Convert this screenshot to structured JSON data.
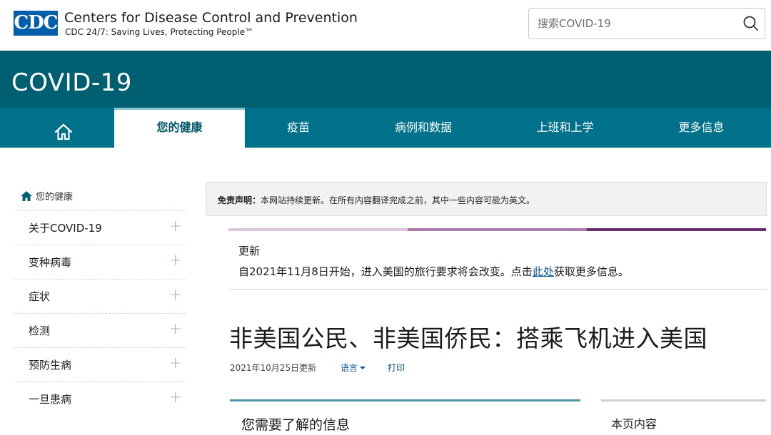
{
  "header": {
    "logo_text": "CDC",
    "agency_name": "Centers for Disease Control and Prevention",
    "tagline": "CDC 24/7: Saving Lives, Protecting People™",
    "search": {
      "placeholder": "搜索COVID-19",
      "value": ""
    }
  },
  "banner": {
    "title": "COVID-19"
  },
  "nav": {
    "items": [
      {
        "label": "",
        "icon": "home-icon"
      },
      {
        "label": "您的健康",
        "active": true
      },
      {
        "label": "疫苗"
      },
      {
        "label": "病例和数据"
      },
      {
        "label": "上班和上学"
      },
      {
        "label": "更多信息"
      }
    ]
  },
  "sidebar": {
    "home_label": "您的健康",
    "items": [
      {
        "label": "关于COVID-19"
      },
      {
        "label": "变种病毒"
      },
      {
        "label": "症状"
      },
      {
        "label": "检测"
      },
      {
        "label": "预防生病"
      },
      {
        "label": "一旦患病"
      }
    ],
    "expand_symbol": "+"
  },
  "disclaimer": {
    "label": "免责声明：",
    "text": "本网站持续更新。在所有内容翻译完成之前，其中一些内容可能为英文。"
  },
  "update": {
    "heading": "更新",
    "text_before": "自2021年11月8日开始，进入美国的旅行要求将会改变。点击",
    "link_text": "此处",
    "text_after": "获取更多信息。"
  },
  "page": {
    "title": "非美国公民、非美国侨民：搭乘飞机进入美国",
    "updated": "2021年10月25日更新",
    "language_label": "语言",
    "print_label": "打印"
  },
  "cards": {
    "main_heading": "您需要了解的信息",
    "toc_heading": "本页内容"
  },
  "colors": {
    "banner": "#005f70",
    "nav": "#00718a",
    "link": "#075290",
    "accent_bar": [
      "#dcc6de",
      "#a87ba8",
      "#6a2c6d"
    ]
  }
}
